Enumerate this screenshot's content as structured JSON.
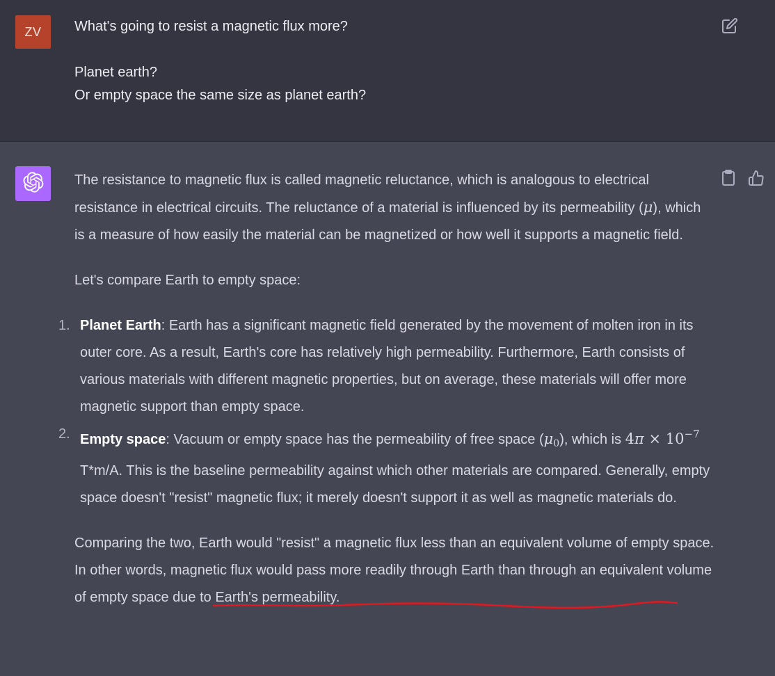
{
  "user_message": {
    "avatar_initials": "ZV",
    "avatar_color": "#b5432c",
    "line1": "What's going to resist a magnetic flux more?",
    "line2": "Planet earth?",
    "line3": "Or empty space the same size as planet earth?",
    "edit_icon": "edit-icon"
  },
  "assistant_message": {
    "avatar_icon": "openai-logo-icon",
    "avatar_color": "#ab68ff",
    "para1_a": "The resistance to magnetic flux is called magnetic reluctance, which is analogous to electrical resistance in electrical circuits. The reluctance of a material is influenced by its permeability (",
    "para1_mu": "μ",
    "para1_b": "), which is a measure of how easily the material can be magnetized or how well it supports a magnetic field.",
    "para2": "Let's compare Earth to empty space:",
    "items": [
      {
        "number": "1.",
        "title": "Planet Earth",
        "text": ": Earth has a significant magnetic field generated by the movement of molten iron in its outer core. As a result, Earth's core has relatively high permeability. Furthermore, Earth consists of various materials with different magnetic properties, but on average, these materials will offer more magnetic support than empty space."
      },
      {
        "number": "2.",
        "title": "Empty space",
        "text_a": ": Vacuum or empty space has the permeability of free space (",
        "mu0": "μ",
        "mu0_sub": "0",
        "text_b": "), which is ",
        "formula_a": "4",
        "formula_pi": "π",
        "formula_b": " × 10",
        "formula_exp": "−7",
        "text_c": " T*m/A. This is the baseline permeability against which other materials are compared. Generally, empty space doesn't \"resist\" magnetic flux; it merely doesn't support it as well as magnetic materials do."
      }
    ],
    "para3_a": "Comparing the two, ",
    "para3_highlight": "Earth would \"resist\" a magnetic flux less than an equivalent volume",
    "para3_b": " of empty space. In other words, magnetic flux would pass more readily through Earth than through an equivalent volume of empty space due to Earth's permeability.",
    "copy_icon": "clipboard-icon",
    "like_icon": "thumbs-up-icon",
    "annotation_color": "#e0191f"
  }
}
